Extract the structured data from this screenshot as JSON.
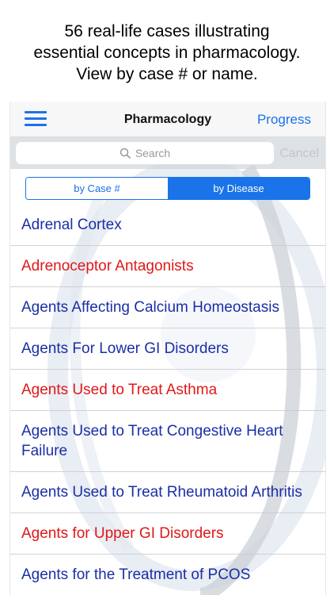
{
  "caption": {
    "line1": "56 real-life cases illustrating",
    "line2": "essential concepts in pharmacology.",
    "line3": "View by case # or name."
  },
  "navbar": {
    "menu_icon": "hamburger-menu-icon",
    "title": "Pharmacology",
    "progress_label": "Progress"
  },
  "search": {
    "icon": "search-icon",
    "placeholder": "Search",
    "value": "",
    "cancel_label": "Cancel"
  },
  "segmented_control": {
    "options": [
      "by Case #",
      "by Disease"
    ],
    "selected": "by Disease"
  },
  "colors": {
    "accent": "#1a73e8",
    "item_blue": "#1a2fa6",
    "item_red": "#e01818"
  },
  "list": {
    "items": [
      {
        "label": "Adrenal Cortex",
        "color": "blue"
      },
      {
        "label": "Adrenoceptor Antagonists",
        "color": "red"
      },
      {
        "label": "Agents Affecting Calcium Homeostasis",
        "color": "blue"
      },
      {
        "label": "Agents For Lower GI Disorders",
        "color": "blue"
      },
      {
        "label": "Agents Used to Treat Asthma",
        "color": "red"
      },
      {
        "label": "Agents Used to Treat Congestive Heart Failure",
        "color": "blue"
      },
      {
        "label": "Agents Used to Treat Rheumatoid Arthritis",
        "color": "blue"
      },
      {
        "label": "Agents for Upper GI Disorders",
        "color": "red"
      },
      {
        "label": "Agents for the Treatment of PCOS",
        "color": "blue"
      }
    ]
  }
}
